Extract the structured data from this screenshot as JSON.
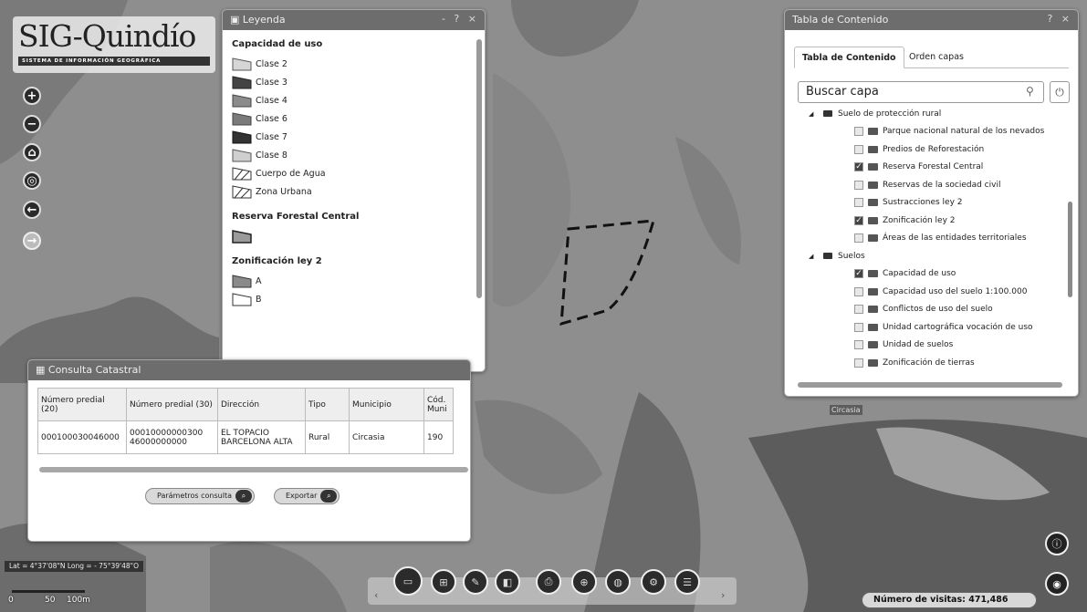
{
  "logo": {
    "title": "SIG-Quindío",
    "subtitle": "SISTEMA DE INFORMACIÓN GEOGRÁFICA"
  },
  "nav": [
    {
      "name": "zoom-in",
      "glyph": "+"
    },
    {
      "name": "zoom-out",
      "glyph": "−"
    },
    {
      "name": "home",
      "glyph": "⌂"
    },
    {
      "name": "locate",
      "glyph": "◎"
    },
    {
      "name": "back",
      "glyph": "←"
    },
    {
      "name": "forward",
      "glyph": "→"
    }
  ],
  "legend": {
    "title": "Leyenda",
    "controls": "- ? ×",
    "sections": [
      {
        "title": "Capacidad de uso",
        "items": [
          {
            "label": "Clase 2",
            "color": "#d6d6d6"
          },
          {
            "label": "Clase 3",
            "color": "#444444"
          },
          {
            "label": "Clase 4",
            "color": "#8c8c8c"
          },
          {
            "label": "Clase 6",
            "color": "#7a7a7a"
          },
          {
            "label": "Clase 7",
            "color": "#333333"
          },
          {
            "label": "Clase 8",
            "color": "#cfcfcf"
          },
          {
            "label": "Cuerpo de Agua",
            "color": "hatch"
          },
          {
            "label": "Zona Urbana",
            "color": "hatch"
          }
        ]
      },
      {
        "title": "Reserva Forestal Central",
        "items": [
          {
            "label": "",
            "color": "#9a9a9a"
          }
        ]
      },
      {
        "title": "Zonificación ley 2",
        "items": [
          {
            "label": "A",
            "color": "#8a8a8a"
          },
          {
            "label": "B",
            "color": "#ffffff"
          }
        ]
      }
    ]
  },
  "toc": {
    "title": "Tabla de Contenido",
    "controls": "? ×",
    "tabs": [
      "Tabla de Contenido",
      "Orden capas"
    ],
    "search_placeholder": "Buscar capa",
    "rows": [
      {
        "type": "group",
        "label": "Suelo de protección rural"
      },
      {
        "type": "layer",
        "label": "Parque nacional natural de los nevados",
        "checked": false
      },
      {
        "type": "layer",
        "label": "Predios de Reforestación",
        "checked": false
      },
      {
        "type": "layer",
        "label": "Reserva Forestal Central",
        "checked": true
      },
      {
        "type": "layer",
        "label": "Reservas de la sociedad civil",
        "checked": false
      },
      {
        "type": "layer",
        "label": "Sustracciones ley 2",
        "checked": false
      },
      {
        "type": "layer",
        "label": "Zonificación ley 2",
        "checked": true
      },
      {
        "type": "layer",
        "label": "Áreas de las entidades territoriales",
        "checked": false
      },
      {
        "type": "group",
        "label": "Suelos"
      },
      {
        "type": "layer",
        "label": "Capacidad de uso",
        "checked": true
      },
      {
        "type": "layer",
        "label": "Capacidad uso del suelo 1:100.000",
        "checked": false
      },
      {
        "type": "layer",
        "label": "Conflictos de uso del suelo",
        "checked": false
      },
      {
        "type": "layer",
        "label": "Unidad cartográfica vocación de uso",
        "checked": false
      },
      {
        "type": "layer",
        "label": "Unidad de suelos",
        "checked": false
      },
      {
        "type": "layer",
        "label": "Zonificación de tierras",
        "checked": false
      }
    ]
  },
  "catastral": {
    "title": "Consulta Catastral",
    "headers": [
      "Número predial (20)",
      "Número predial (30)",
      "Dirección",
      "Tipo",
      "Municipio",
      "Cód. Muni"
    ],
    "row": [
      "000100030046000",
      "00010000000300 46000000000",
      "EL TOPACIO BARCELONA ALTA",
      "Rural",
      "Circasia",
      "190"
    ],
    "buttons": [
      "Parámetros consulta",
      "Exportar"
    ]
  },
  "coords": "Lat = 4°37'08\"N Long = - 75°39'48\"O",
  "scale": {
    "labels": [
      "0",
      "50",
      "100m"
    ]
  },
  "place_label": "Circasia",
  "visits": {
    "label": "Número de visitas:",
    "value": "471,486"
  },
  "toolbar": {
    "count": 9
  }
}
